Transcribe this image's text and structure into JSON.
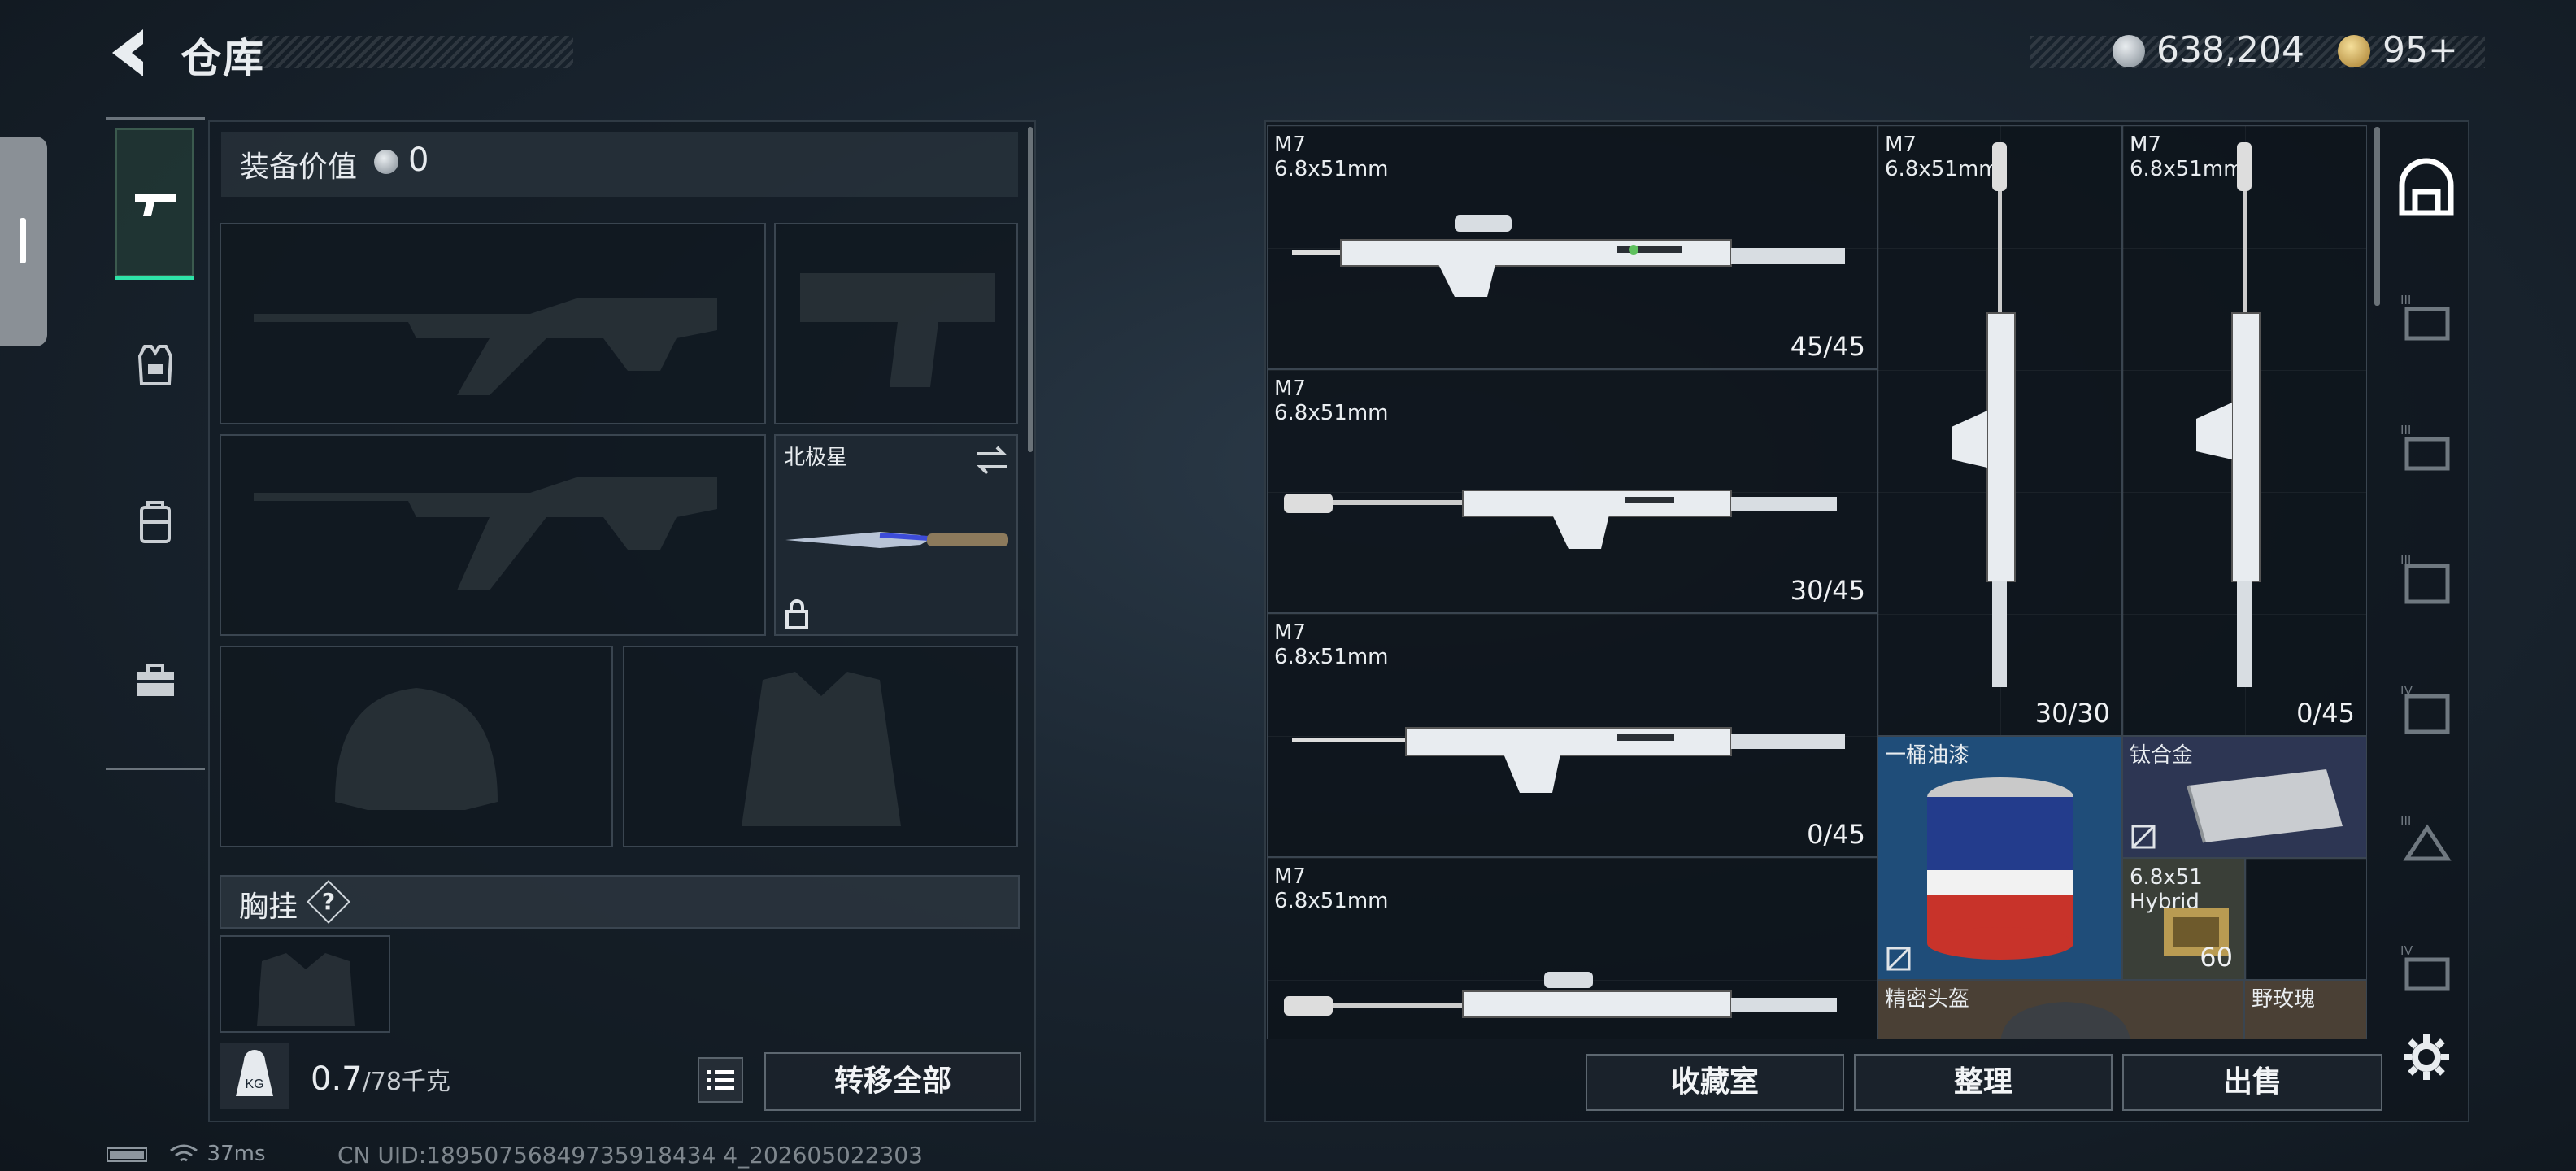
{
  "header": {
    "back_icon": "chevron-left-icon",
    "title": "仓库",
    "currency_silver": "638,204",
    "currency_gold": "95+"
  },
  "edge_tab": {
    "icon": "drawer-handle-icon"
  },
  "left_rail": {
    "items": [
      {
        "icon": "pistol-icon",
        "active": true
      },
      {
        "icon": "armor-vest-icon",
        "active": false
      },
      {
        "icon": "backpack-icon",
        "active": false
      },
      {
        "icon": "toolbox-icon",
        "active": false
      }
    ]
  },
  "equipment": {
    "value_label": "装备价值",
    "value": "0",
    "melee": {
      "label": "北极星"
    },
    "chest_rig_label": "胸挂",
    "chest_rig_help": "?",
    "weight_current": "0.7",
    "weight_max": "/78千克",
    "kg_badge": "KG",
    "transfer_all": "转移全部"
  },
  "stash": {
    "items": [
      {
        "name": "M7",
        "sub": "6.8x51mm",
        "count": "45/45"
      },
      {
        "name": "M7",
        "sub": "6.8x51mm",
        "count": "30/45"
      },
      {
        "name": "M7",
        "sub": "6.8x51mm",
        "count": "0/45"
      },
      {
        "name": "M7",
        "sub": "6.8x51mm",
        "count": ""
      },
      {
        "name": "M7",
        "sub": "6.8x51mm",
        "count": "30/30"
      },
      {
        "name": "M7",
        "sub": "6.8x51mm",
        "count": "0/45"
      },
      {
        "name": "一桶油漆",
        "sub": "",
        "count": ""
      },
      {
        "name": "钛合金",
        "sub": "",
        "count": ""
      },
      {
        "name": "6.8x51",
        "sub": "Hybrid",
        "count": "60"
      },
      {
        "name": "精密头盔",
        "sub": "",
        "count": ""
      },
      {
        "name": "野玫瑰",
        "sub": "",
        "count": ""
      }
    ],
    "collection_btn": "收藏室",
    "sort_btn": "整理",
    "sell_btn": "出售"
  },
  "right_rail": {
    "items": [
      "backpack-active-icon",
      "tier-iii-rig-icon",
      "tier-iii-rig-icon",
      "tier-iii-pack-icon",
      "tier-iv-pack-icon",
      "tier-iii-case-icon",
      "tier-iv-case-icon"
    ],
    "tiers": [
      "",
      "III",
      "III",
      "III",
      "IV",
      "III",
      "IV"
    ],
    "settings_icon": "gear-icon"
  },
  "status": {
    "ping": "37ms",
    "uid": "CN UID:18950756849735918434 4_202605022303"
  },
  "colors": {
    "accent": "#2ee3a8",
    "panel": "#141c24"
  }
}
